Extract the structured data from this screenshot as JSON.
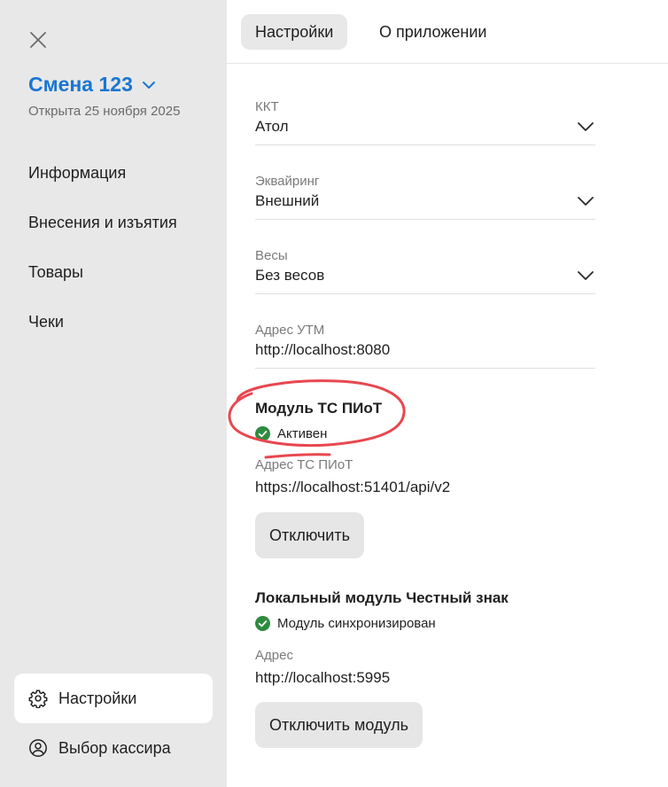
{
  "sidebar": {
    "shift_title": "Смена 123",
    "shift_subtitle": "Открыта 25 ноября 2025",
    "nav": [
      {
        "label": "Информация"
      },
      {
        "label": "Внесения и изъятия"
      },
      {
        "label": "Товары"
      },
      {
        "label": "Чеки"
      }
    ],
    "settings_label": "Настройки",
    "cashier_label": "Выбор кассира"
  },
  "tabs": [
    {
      "label": "Настройки",
      "active": true
    },
    {
      "label": "О приложении",
      "active": false
    }
  ],
  "settings": {
    "kkt": {
      "label": "ККТ",
      "value": "Атол"
    },
    "acquiring": {
      "label": "Эквайринг",
      "value": "Внешний"
    },
    "scales": {
      "label": "Весы",
      "value": "Без весов"
    },
    "utm": {
      "label": "Адрес УТМ",
      "value": "http://localhost:8080"
    }
  },
  "ts_piot": {
    "title": "Модуль ТС ПИоТ",
    "status": "Активен",
    "address_label": "Адрес ТС ПИоТ",
    "address_value": "https://localhost:51401/api/v2",
    "disable_button": "Отключить"
  },
  "local_module": {
    "title": "Локальный модуль Честный знак",
    "status": "Модуль синхронизирован",
    "address_label": "Адрес",
    "address_value": "http://localhost:5995",
    "disable_button": "Отключить модуль"
  },
  "colors": {
    "accent": "#1976d2",
    "success": "#2e8b3e",
    "annotation": "#e8474f",
    "sidebar_bg": "#e8e8e8"
  }
}
